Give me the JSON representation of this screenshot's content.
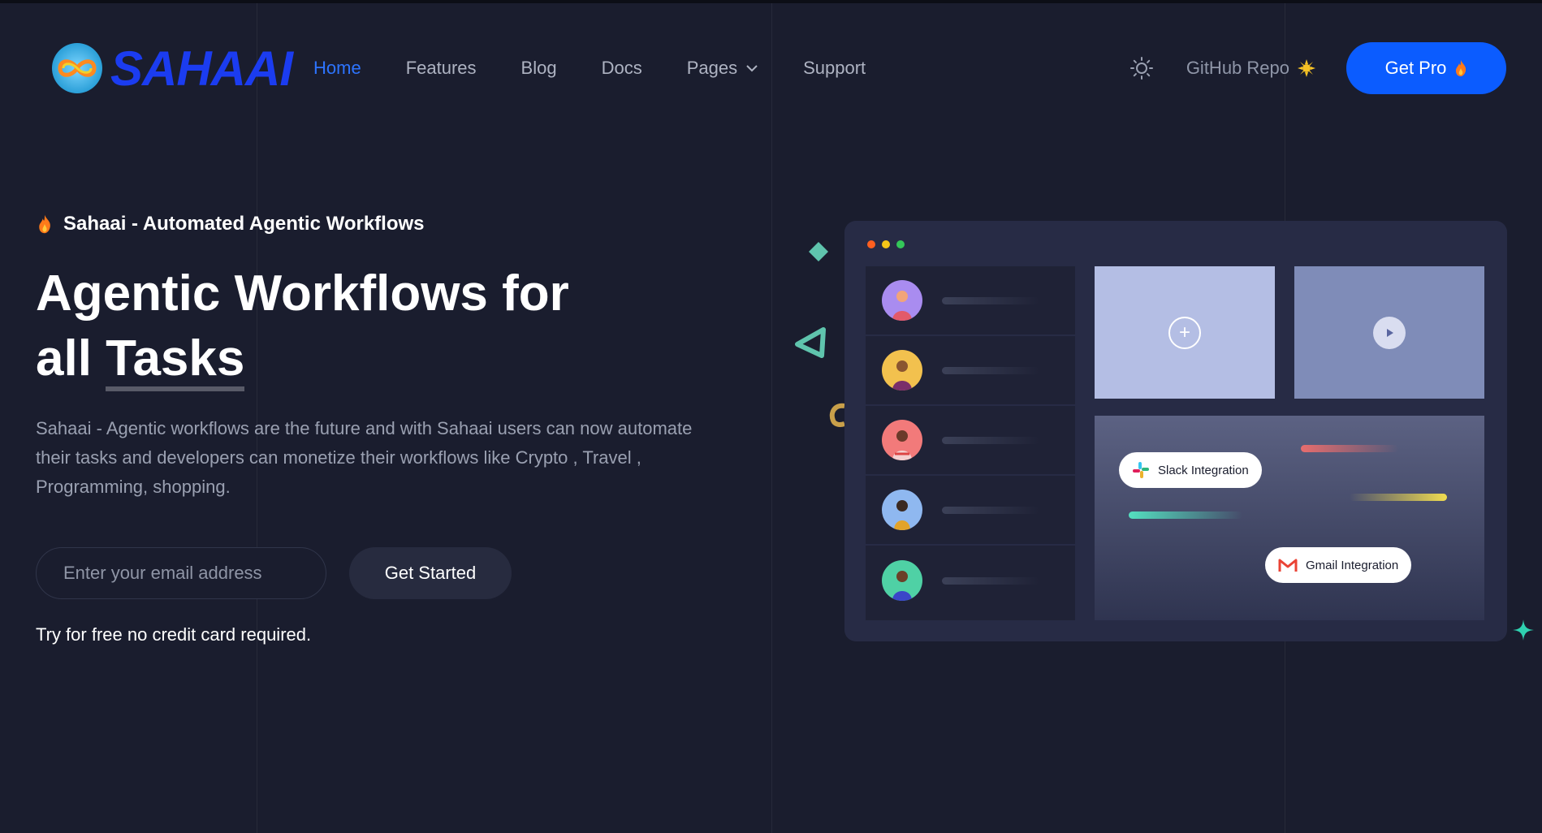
{
  "brand": {
    "name": "SAHAAI"
  },
  "nav": {
    "items": [
      {
        "label": "Home",
        "active": true
      },
      {
        "label": "Features"
      },
      {
        "label": "Blog"
      },
      {
        "label": "Docs"
      },
      {
        "label": "Pages",
        "has_dropdown": true
      },
      {
        "label": "Support"
      }
    ]
  },
  "header": {
    "theme_toggle_icon": "sun-icon",
    "github_label": "GitHub Repo",
    "pro_label": "Get Pro"
  },
  "hero": {
    "eyebrow": "Sahaai - Automated Agentic Workflows",
    "title_line1": "Agentic Workflows for",
    "title_line2_prefix": "all ",
    "title_line2_highlight": "Tasks",
    "description": "Sahaai - Agentic workflows are the future and with Sahaai users can now automate their tasks and developers can monetize their workflows like Crypto , Travel , Programming, shopping.",
    "email_placeholder": "Enter your email address",
    "cta_label": "Get Started",
    "note": "Try for free no credit card required."
  },
  "mockup": {
    "window_dots": [
      "#ff5f1f",
      "#f5c518",
      "#34c759"
    ],
    "integrations": [
      {
        "label": "Slack Integration",
        "icon": "slack-icon"
      },
      {
        "label": "Gmail Integration",
        "icon": "gmail-icon"
      }
    ]
  },
  "colors": {
    "background": "#1a1d2e",
    "accent": "#0b5cff",
    "brand": "#1b3cf0"
  }
}
